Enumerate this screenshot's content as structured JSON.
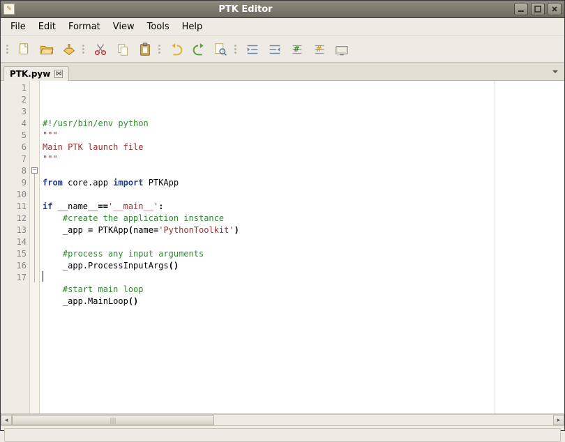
{
  "window": {
    "title": "PTK Editor"
  },
  "menubar": {
    "items": [
      "File",
      "Edit",
      "Format",
      "View",
      "Tools",
      "Help"
    ]
  },
  "toolbar": {
    "groups": [
      [
        "new",
        "open",
        "save"
      ],
      [
        "cut",
        "copy",
        "paste"
      ],
      [
        "undo",
        "redo",
        "find"
      ],
      [
        "indent",
        "outdent",
        "comment",
        "uncomment",
        "run"
      ]
    ]
  },
  "tabs": {
    "items": [
      {
        "label": "PTK.pyw",
        "active": true
      }
    ]
  },
  "editor": {
    "line_count": 17,
    "fold_at": 8,
    "lines": [
      {
        "n": 1,
        "tokens": [
          [
            "comment",
            "#!/usr/bin/env python"
          ]
        ]
      },
      {
        "n": 2,
        "tokens": [
          [
            "str",
            "\"\"\""
          ]
        ]
      },
      {
        "n": 3,
        "tokens": [
          [
            "str",
            "Main PTK launch file"
          ]
        ]
      },
      {
        "n": 4,
        "tokens": [
          [
            "str",
            "\"\"\""
          ]
        ]
      },
      {
        "n": 5,
        "tokens": []
      },
      {
        "n": 6,
        "tokens": [
          [
            "kw",
            "from"
          ],
          [
            "name",
            " core.app "
          ],
          [
            "kw",
            "import"
          ],
          [
            "name",
            " PTKApp"
          ]
        ]
      },
      {
        "n": 7,
        "tokens": []
      },
      {
        "n": 8,
        "tokens": [
          [
            "kw",
            "if"
          ],
          [
            "name",
            " __name__"
          ],
          [
            "punct",
            "=="
          ],
          [
            "str",
            "'__main__'"
          ],
          [
            "punct",
            ":"
          ]
        ]
      },
      {
        "n": 9,
        "tokens": [
          [
            "name",
            "    "
          ],
          [
            "comment",
            "#create the application instance"
          ]
        ]
      },
      {
        "n": 10,
        "tokens": [
          [
            "name",
            "    _app "
          ],
          [
            "punct",
            "="
          ],
          [
            "name",
            " PTKApp"
          ],
          [
            "punct",
            "("
          ],
          [
            "name",
            "name"
          ],
          [
            "punct",
            "="
          ],
          [
            "str",
            "'PythonToolkit'"
          ],
          [
            "punct",
            ")"
          ]
        ]
      },
      {
        "n": 11,
        "tokens": []
      },
      {
        "n": 12,
        "tokens": [
          [
            "name",
            "    "
          ],
          [
            "comment",
            "#process any input arguments"
          ]
        ]
      },
      {
        "n": 13,
        "tokens": [
          [
            "name",
            "    _app.ProcessInputArgs"
          ],
          [
            "punct",
            "()"
          ]
        ]
      },
      {
        "n": 14,
        "tokens": []
      },
      {
        "n": 15,
        "tokens": [
          [
            "name",
            "    "
          ],
          [
            "comment",
            "#start main loop"
          ]
        ]
      },
      {
        "n": 16,
        "tokens": [
          [
            "name",
            "    _app.MainLoop"
          ],
          [
            "punct",
            "()"
          ]
        ]
      },
      {
        "n": 17,
        "tokens": []
      }
    ]
  }
}
